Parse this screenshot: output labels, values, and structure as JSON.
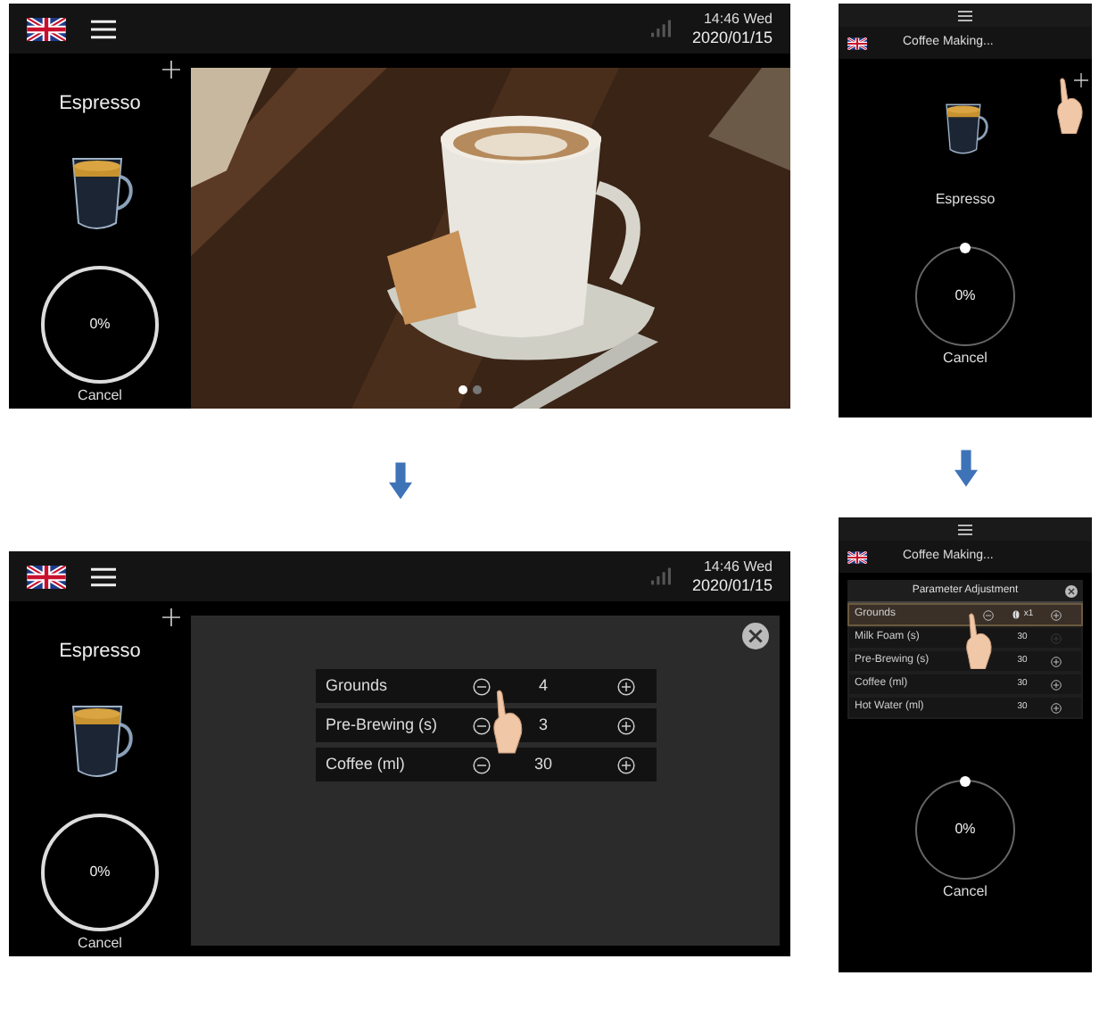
{
  "screens": [
    {
      "kind": "home",
      "time": "14:46 Wed",
      "date": "2020/01/15",
      "drink": "Espresso",
      "progress": "0%",
      "cancel": "Cancel",
      "slides": [
        {
          "selected": true
        },
        {
          "selected": false
        }
      ]
    },
    {
      "kind": "adjust",
      "time": "14:46 Wed",
      "date": "2020/01/15",
      "drink": "Espresso",
      "progress": "0%",
      "cancel": "Cancel",
      "params": [
        {
          "label": "Grounds",
          "value": "4"
        },
        {
          "label": "Pre-Brewing (s)",
          "value": "3"
        },
        {
          "label": "Coffee (ml)",
          "value": "30"
        }
      ]
    }
  ],
  "phone_screens": [
    {
      "kind": "making",
      "title": "Coffee Making...",
      "drink": "Espresso",
      "progress": "0%",
      "cancel": "Cancel"
    },
    {
      "kind": "making_adjust",
      "title": "Coffee Making...",
      "panel_title": "Parameter Adjustment",
      "progress": "0%",
      "cancel": "Cancel",
      "params": [
        {
          "label": "Grounds",
          "value": "x1",
          "selected": true,
          "disabled": false
        },
        {
          "label": "Milk Foam (s)",
          "value": "30",
          "selected": false,
          "disabled": true
        },
        {
          "label": "Pre-Brewing (s)",
          "value": "30",
          "selected": false,
          "disabled": false
        },
        {
          "label": "Coffee (ml)",
          "value": "30",
          "selected": false,
          "disabled": false
        },
        {
          "label": "Hot Water (ml)",
          "value": "30",
          "selected": false,
          "disabled": false
        }
      ]
    }
  ]
}
